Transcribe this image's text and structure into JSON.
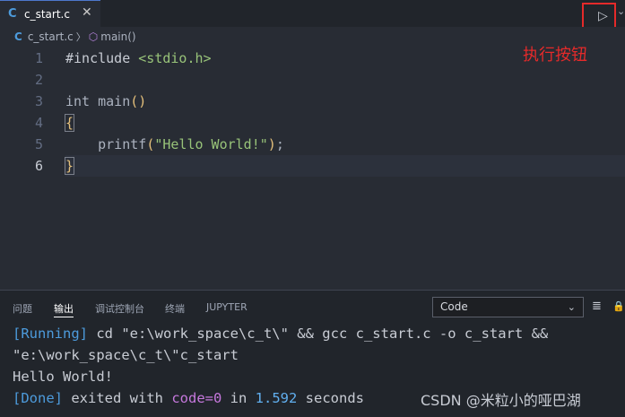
{
  "tab": {
    "icon": "C",
    "filename": "c_start.c",
    "close": "✕"
  },
  "toolbar": {
    "run_icon": "▷",
    "more": "⌄"
  },
  "breadcrumb": {
    "icon": "C",
    "file": "c_start.c",
    "sep": "〉",
    "symbol_icon": "⬡",
    "symbol": "main()"
  },
  "line_numbers": [
    "1",
    "2",
    "3",
    "4",
    "5",
    "6"
  ],
  "code": {
    "l1_directive": "#include ",
    "l1_header": "<stdio.h>",
    "l3_type": "int ",
    "l3_name": "main",
    "l3_paren": "()",
    "l4_brace": "{",
    "l5_indent": "    ",
    "l5_fn": "printf",
    "l5_open": "(",
    "l5_str": "\"Hello World!\"",
    "l5_close": ")",
    "l5_semi": ";",
    "l6_brace": "}"
  },
  "annotation": "执行按钮",
  "panel": {
    "tabs": [
      "问题",
      "输出",
      "调试控制台",
      "终端",
      "JUPYTER"
    ],
    "active_tab": "输出",
    "select_value": "Code",
    "select_chevron": "⌄",
    "icon_list": "≣",
    "icon_lock": "🔒"
  },
  "output": {
    "line1_tag": "[Running]",
    "line1_cmd": " cd \"e:\\work_space\\c_t\\\" && gcc c_start.c -o c_start &&",
    "line2": "\"e:\\work_space\\c_t\\\"c_start",
    "line3": "Hello World!",
    "line4_tag": "[Done]",
    "line4_a": " exited with ",
    "line4_code": "code=0",
    "line4_b": " in ",
    "line4_time": "1.592",
    "line4_c": " seconds"
  },
  "watermark": "CSDN @米粒小的哑巴湖",
  "colors": {
    "accent_red": "#e52a2a",
    "c_icon": "#4d9bdc",
    "background": "#282c34"
  }
}
